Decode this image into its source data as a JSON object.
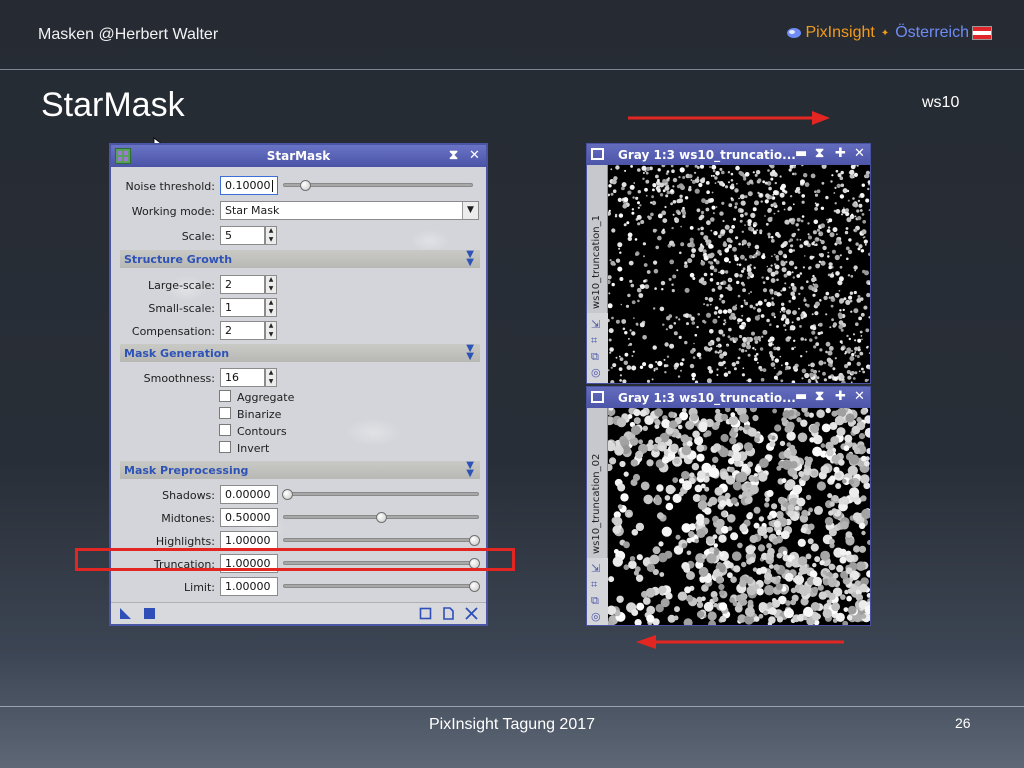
{
  "slide": {
    "header_left": "Masken  @Herbert Walter",
    "brand_name": "PixInsight",
    "brand_country": "Österreich",
    "title": "StarMask",
    "ws_label": "ws10",
    "footer": "PixInsight Tagung 2017",
    "page_number": "26"
  },
  "colors": {
    "background": "#262b33",
    "highlight_red": "#e32622",
    "pi_window_blue": "#4b55a6",
    "section_text": "#2e53b8",
    "brand_orange": "#f29a1c",
    "brand_blue": "#6f8cf5"
  },
  "dialog": {
    "title": "StarMask",
    "noise_threshold": {
      "label": "Noise threshold:",
      "value": "0.10000",
      "slider": 0.1
    },
    "working_mode": {
      "label": "Working mode:",
      "value": "Star Mask"
    },
    "scale": {
      "label": "Scale:",
      "value": "5"
    },
    "structure_growth": {
      "header": "Structure Growth",
      "large_scale": {
        "label": "Large-scale:",
        "value": "2"
      },
      "small_scale": {
        "label": "Small-scale:",
        "value": "1"
      },
      "compensation": {
        "label": "Compensation:",
        "value": "2"
      }
    },
    "mask_generation": {
      "header": "Mask Generation",
      "smoothness": {
        "label": "Smoothness:",
        "value": "16"
      },
      "checkboxes": [
        {
          "label": "Aggregate",
          "checked": false
        },
        {
          "label": "Binarize",
          "checked": false
        },
        {
          "label": "Contours",
          "checked": false
        },
        {
          "label": "Invert",
          "checked": false
        }
      ]
    },
    "mask_preprocessing": {
      "header": "Mask Preprocessing",
      "shadows": {
        "label": "Shadows:",
        "value": "0.00000",
        "slider": 0.0
      },
      "midtones": {
        "label": "Midtones:",
        "value": "0.50000",
        "slider": 0.5
      },
      "highlights": {
        "label": "Highlights:",
        "value": "1.00000",
        "slider": 1.0
      },
      "truncation": {
        "label": "Truncation:",
        "value": "1.00000",
        "slider": 1.0
      },
      "limit": {
        "label": "Limit:",
        "value": "1.00000",
        "slider": 1.0
      }
    }
  },
  "image_windows": [
    {
      "title": "Gray 1:3 ws10_truncatio...",
      "tab": "ws10_truncation_1"
    },
    {
      "title": "Gray 1:3 ws10_truncatio...",
      "tab": "ws10_truncation_02"
    }
  ]
}
